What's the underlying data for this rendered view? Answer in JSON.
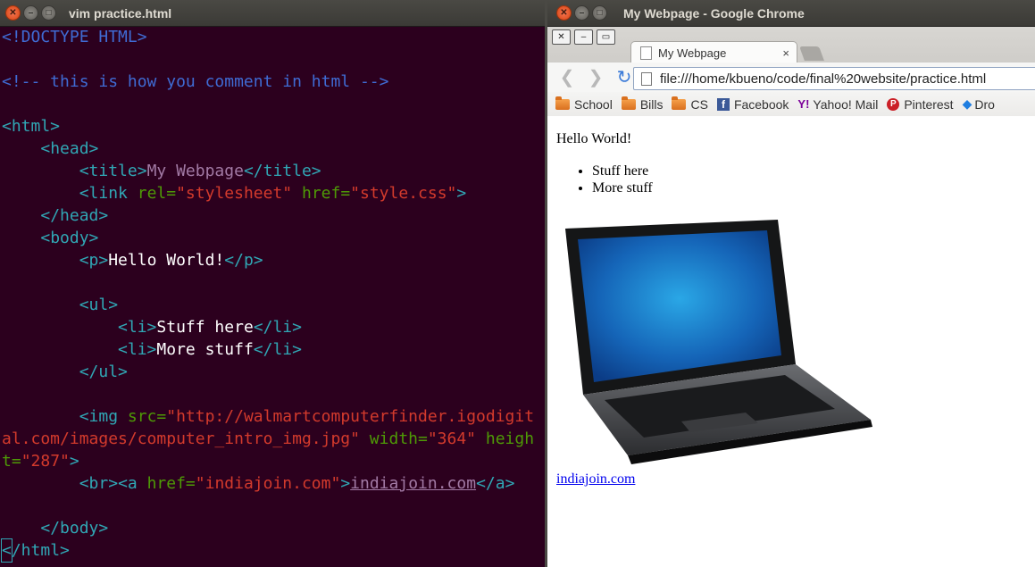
{
  "terminal": {
    "title": "vim practice.html",
    "lines": {
      "doctype": "<!DOCTYPE HTML>",
      "comment": "<!-- this is how you comment in html -->",
      "html_open": "<html>",
      "head_open": "<head>",
      "title_open": "<title>",
      "title_text": "My Webpage",
      "title_close": "</title>",
      "link_open": "<link ",
      "link_rel_attr": "rel=",
      "link_rel_val": "\"stylesheet\"",
      "link_href_attr": " href=",
      "link_href_val": "\"style.css\"",
      "link_close": ">",
      "head_close": "</head>",
      "body_open": "<body>",
      "p_open": "<p>",
      "p_text": "Hello World!",
      "p_close": "</p>",
      "ul_open": "<ul>",
      "li_open": "<li>",
      "li1_text": "Stuff here",
      "li2_text": "More stuff",
      "li_close": "</li>",
      "ul_close": "</ul>",
      "img_open": "<img ",
      "img_src_attr": "src=",
      "img_src_val1": "\"http://walmartcomputerfinder.igodigit",
      "img_src_val2": "al.com/images/computer_intro_img.jpg\"",
      "img_width_attr": " width=",
      "img_width_val": "\"364\"",
      "img_height_attr1": " heigh",
      "img_height_attr2": "t=",
      "img_height_val": "\"287\"",
      "img_close": ">",
      "br": "<br>",
      "a_open": "<a ",
      "a_href_attr": "href=",
      "a_href_val": "\"indiajoin.com\"",
      "a_close_bracket": ">",
      "a_text": "indiajoin.com",
      "a_close": "</a>",
      "body_close": "</body>",
      "html_close_lt": "<",
      "html_close_rest": "/html>"
    }
  },
  "browser": {
    "window_title": "My Webpage - Google Chrome",
    "tab_title": "My Webpage",
    "tab_close": "×",
    "url": "file:///home/kbueno/code/final%20website/practice.html",
    "bookmarks": [
      "School",
      "Bills",
      "CS",
      "Facebook",
      "Yahoo! Mail",
      "Pinterest",
      "Dro"
    ],
    "page": {
      "paragraph": "Hello World!",
      "list": [
        "Stuff here",
        "More stuff"
      ],
      "link_text": "indiajoin.com"
    }
  },
  "colors": {
    "terminal_bg": "#2c001e",
    "tag": "#30a7b5",
    "string": "#d33a2c",
    "attribute": "#4e9a06",
    "comment": "#3f6bd4",
    "link": "#0000ee"
  },
  "icons": [
    "close-icon",
    "minimize-icon",
    "maximize-icon",
    "back-icon",
    "forward-icon",
    "reload-icon",
    "folder-icon",
    "facebook-icon",
    "yahoo-icon",
    "pinterest-icon",
    "dropbox-icon",
    "laptop-image"
  ]
}
